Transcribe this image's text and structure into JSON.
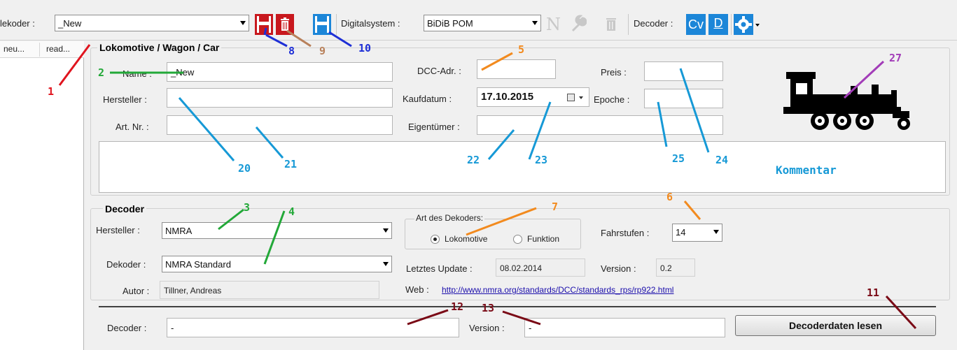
{
  "toolbar": {
    "decoder_label": "lekoder :",
    "decoder_value": "_New",
    "digitalsystem_label": "Digitalsystem :",
    "digitalsystem_value": "BiDiB POM",
    "n_label": "N",
    "decoder2_label": "Decoder :",
    "cv_label": "Cv",
    "d_label": "D"
  },
  "side_columns": [
    "neu...",
    "read..."
  ],
  "loco": {
    "group_title": "Lokomotive / Wagon / Car",
    "name_label": "Name :",
    "name_value": "_New",
    "hersteller_label": "Hersteller :",
    "hersteller_value": "",
    "artnr_label": "Art. Nr. :",
    "artnr_value": "",
    "dcc_label": "DCC-Adr. :",
    "dcc_value": "",
    "kaufdatum_label": "Kaufdatum :",
    "kaufdatum_value": "17.10.2015",
    "eigentuemer_label": "Eigentümer :",
    "eigentuemer_value": "",
    "preis_label": "Preis :",
    "preis_value": "",
    "epoche_label": "Epoche :",
    "epoche_value": "",
    "comment_value": ""
  },
  "decoder": {
    "group_title": "Decoder",
    "hersteller_label": "Hersteller :",
    "hersteller_value": "NMRA",
    "dekoder_label": "Dekoder :",
    "dekoder_value": "NMRA Standard",
    "autor_label": "Autor :",
    "autor_value": "Tillner, Andreas",
    "art_title": "Art des Dekoders:",
    "radio_lok": "Lokomotive",
    "radio_funktion": "Funktion",
    "fahrstufen_label": "Fahrstufen :",
    "fahrstufen_value": "14",
    "update_label": "Letztes Update :",
    "update_value": "08.02.2014",
    "version_label": "Version :",
    "version_value": "0.2",
    "web_label": "Web :",
    "web_value": "http://www.nmra.org/standards/DCC/standards_rps/rp922.html"
  },
  "bottom": {
    "decoder_label": "Decoder :",
    "decoder_value": "-",
    "version_label": "Version :",
    "version_value": "-",
    "read_button": "Decoderdaten lesen"
  },
  "annotations": {
    "n1": "1",
    "n2": "2",
    "n3": "3",
    "n4": "4",
    "n5": "5",
    "n6": "6",
    "n7": "7",
    "n8": "8",
    "n9": "9",
    "n10": "10",
    "n11": "11",
    "n12": "12",
    "n13": "13",
    "n20": "20",
    "n21": "21",
    "n22": "22",
    "n23": "23",
    "n24": "24",
    "n25": "25",
    "n27": "27",
    "kommentar": "Kommentar"
  },
  "colors": {
    "red": "#e0141e",
    "green": "#22a838",
    "blue": "#1e2fd6",
    "brown": "#b8805a",
    "cyan": "#1699d6",
    "orange": "#f28a1e",
    "dark_red": "#7a0a16",
    "purple": "#a23cb8",
    "save_red": "#c8181e",
    "save_blue": "#1c86d8"
  },
  "icons": [
    "save-red-icon",
    "delete-icon",
    "save-blue-icon",
    "new-icon",
    "wrench-icon",
    "trash-icon",
    "cv-icon",
    "d-arrow-icon",
    "gear-icon",
    "locomotive-icon"
  ]
}
